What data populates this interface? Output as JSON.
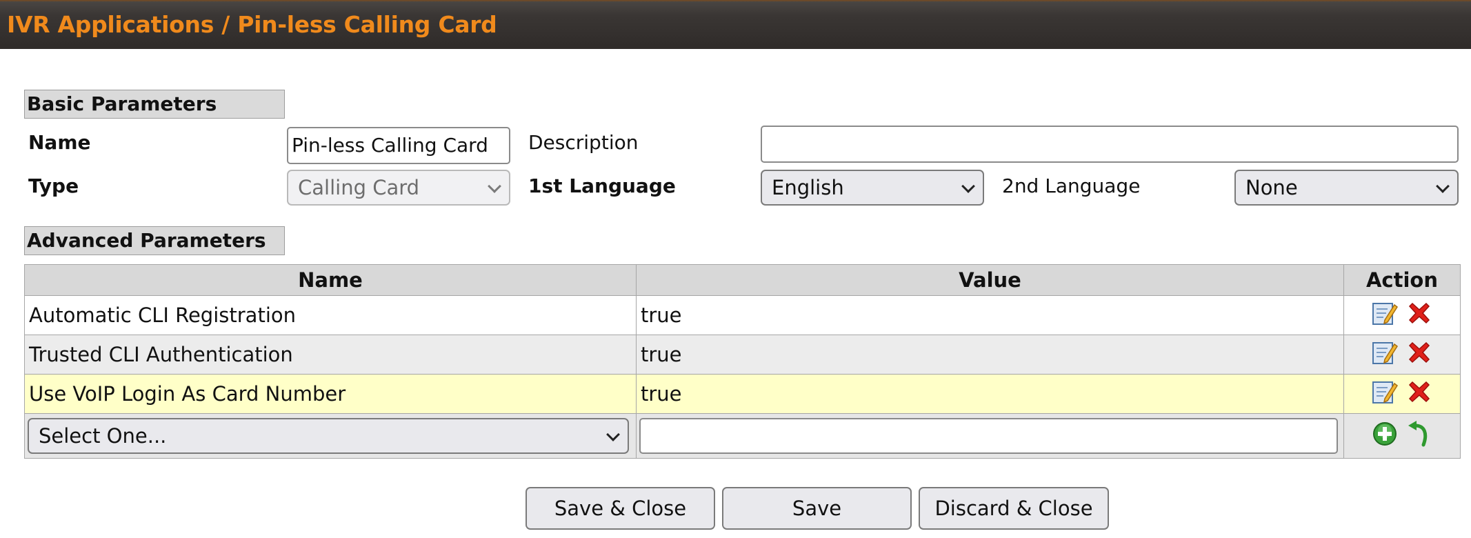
{
  "header": {
    "breadcrumb_root": "IVR Applications",
    "breadcrumb_separator": "/",
    "breadcrumb_current": "Pin-less Calling Card"
  },
  "basic": {
    "section_title": "Basic Parameters",
    "name_label": "Name",
    "name_value": "Pin-less Calling Card",
    "description_label": "Description",
    "description_value": "",
    "type_label": "Type",
    "type_value": "Calling Card",
    "lang1_label": "1st Language",
    "lang1_value": "English",
    "lang2_label": "2nd Language",
    "lang2_value": "None"
  },
  "advanced": {
    "section_title": "Advanced Parameters",
    "columns": [
      "Name",
      "Value",
      "Action"
    ],
    "rows": [
      {
        "name": "Automatic CLI Registration",
        "value": "true"
      },
      {
        "name": "Trusted CLI Authentication",
        "value": "true"
      },
      {
        "name": "Use VoIP Login As Card Number",
        "value": "true"
      }
    ],
    "add_row": {
      "select_placeholder": "Select One...",
      "value_input": ""
    }
  },
  "icons": {
    "edit": "edit-pencil-icon",
    "delete": "delete-x-icon",
    "add": "add-plus-icon",
    "undo": "undo-arrow-icon"
  },
  "colors": {
    "title_text": "#f08a1c",
    "highlight_row": "#ffffc8",
    "delete_red": "#e0201a",
    "add_green": "#3aa23a"
  },
  "footer": {
    "save_close": "Save & Close",
    "save": "Save",
    "discard_close": "Discard & Close"
  }
}
